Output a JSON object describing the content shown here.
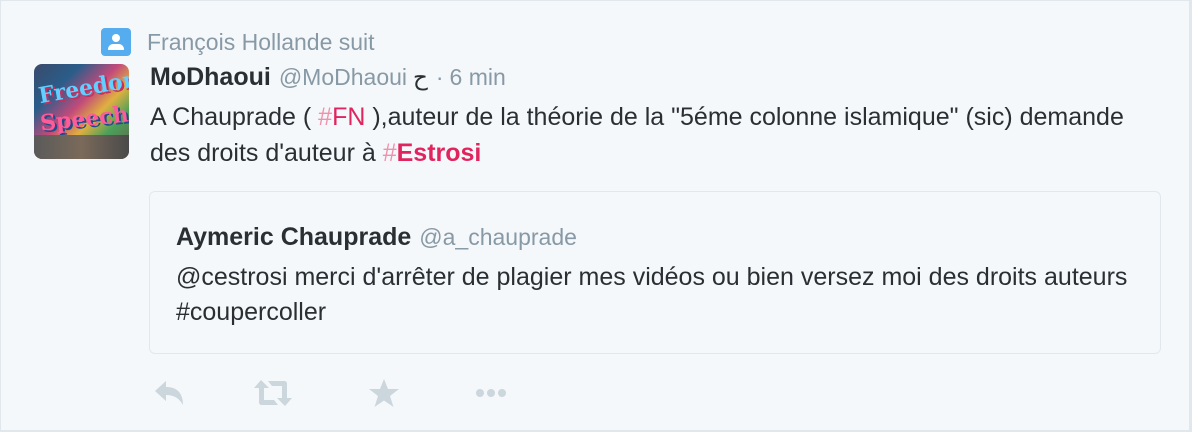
{
  "context": {
    "icon": "follow-person-icon",
    "text": "François Hollande suit"
  },
  "tweet": {
    "avatar_alt": "profile-avatar",
    "fullname": "MoDhaoui",
    "username": "@MoDhaoui",
    "badge": "ح",
    "separator": "·",
    "time": "6 min",
    "text_part1": "A Chauprade ( ",
    "hashtag1_hash": "#",
    "hashtag1_term": "FN",
    "text_part2": " ),auteur de la théorie de la \"5éme colonne islamique\" (sic) demande des droits d'auteur à ",
    "hashtag2_hash": "#",
    "hashtag2_term": "Estrosi"
  },
  "quote": {
    "fullname": "Aymeric Chauprade",
    "username": "@a_chauprade",
    "text": "@cestrosi merci d'arrêter de plagier mes vidéos ou bien versez moi des droits auteurs #coupercoller"
  },
  "actions": {
    "reply_icon": "reply-icon",
    "retweet_icon": "retweet-icon",
    "favorite_icon": "star-icon",
    "more_icon": "more-icon"
  },
  "colors": {
    "background": "#f5f8fa",
    "hashtag": "#e0245e",
    "muted": "#8899a6",
    "accent": "#55acee",
    "text": "#292f33"
  }
}
